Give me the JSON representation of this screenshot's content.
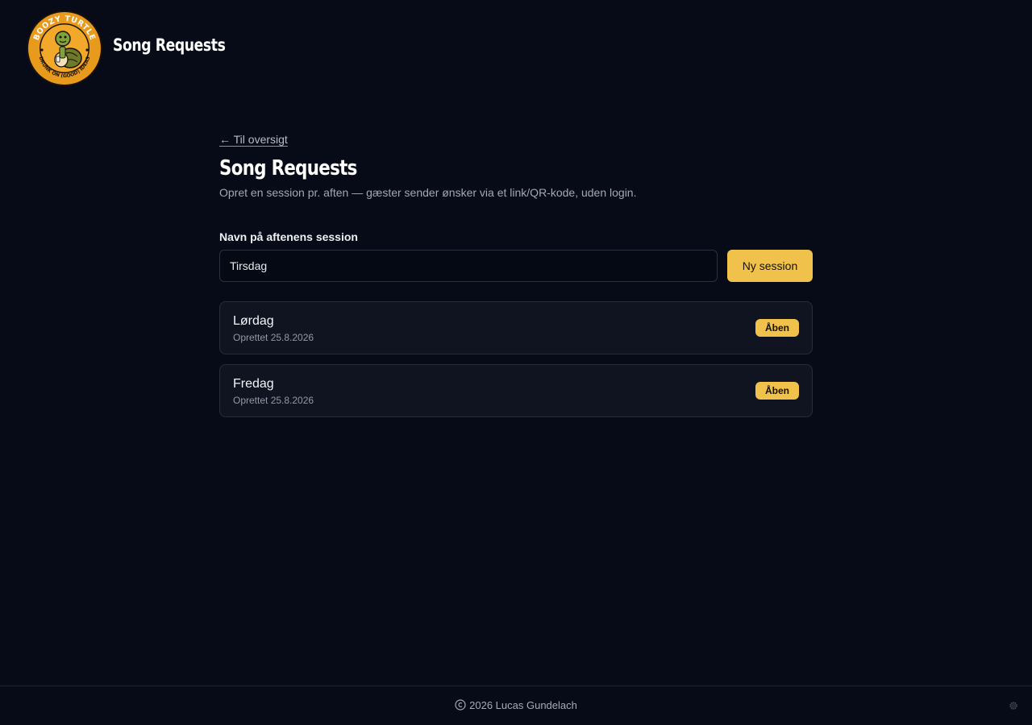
{
  "header": {
    "logo_text_top": "BOOZY TURTLE",
    "logo_text_bottom": "DRUNK ON (GOOD) IDEAS",
    "title": "Song Requests",
    "colors": {
      "logo_ring": "#e79a1c",
      "logo_dark": "#1a1208"
    }
  },
  "main": {
    "back_link": "← Til oversigt",
    "title": "Song Requests",
    "subtitle": "Opret en session pr. aften — gæster sender ønsker via et link/QR-kode, uden login.",
    "form": {
      "label": "Navn på aftenens session",
      "input_value": "Tirsdag",
      "button_label": "Ny session"
    },
    "sessions": [
      {
        "name": "Lørdag",
        "created": "Oprettet 25.8.2026",
        "status": "Åben"
      },
      {
        "name": "Fredag",
        "created": "Oprettet 25.8.2026",
        "status": "Åben"
      }
    ],
    "colors": {
      "accent": "#f0c24b",
      "background": "#060b17",
      "card": "#0f1420"
    }
  },
  "footer": {
    "copyright": "2026 Lucas Gundelach",
    "icons": [
      "copyright-icon",
      "gear-icon"
    ]
  }
}
